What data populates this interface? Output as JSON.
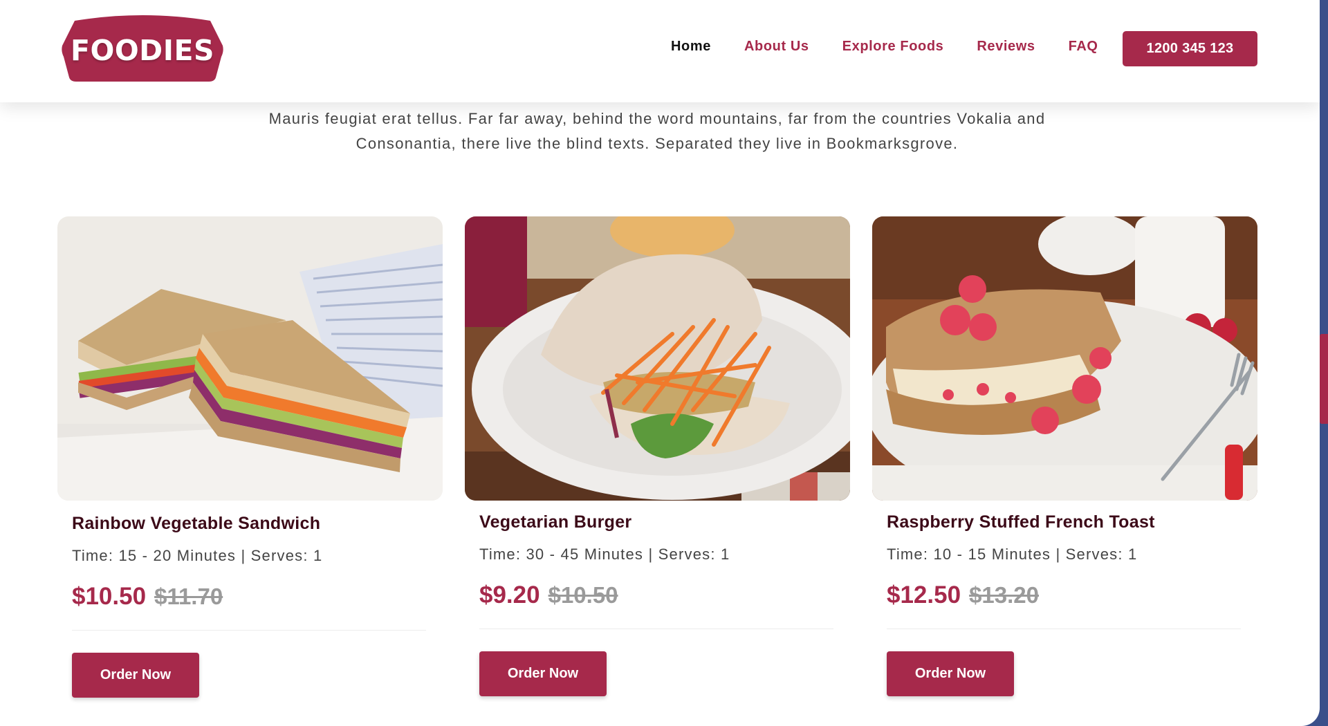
{
  "header": {
    "logo_text": "FOODIES",
    "nav": [
      {
        "label": "Home",
        "active": true
      },
      {
        "label": "About Us",
        "active": false
      },
      {
        "label": "Explore Foods",
        "active": false
      },
      {
        "label": "Reviews",
        "active": false
      },
      {
        "label": "FAQ",
        "active": false
      }
    ],
    "phone": "1200 345 123"
  },
  "intro": {
    "line1": "Mauris feugiat erat tellus. Far far away, behind the word mountains, far from the countries Vokalia and",
    "line2": "Consonantia, there live the blind texts. Separated they live in Bookmarksgrove."
  },
  "cards": [
    {
      "title": "Rainbow Vegetable Sandwich",
      "meta": "Time: 15 - 20 Minutes | Serves: 1",
      "price": "$10.50",
      "old_price": "$11.70",
      "button": "Order Now",
      "image": "rainbow-vegetable-sandwich-photo"
    },
    {
      "title": "Vegetarian Burger",
      "meta": "Time: 30 - 45 Minutes | Serves: 1",
      "price": "$9.20",
      "old_price": "$10.50",
      "button": "Order Now",
      "image": "vegetarian-burger-photo"
    },
    {
      "title": "Raspberry Stuffed French Toast",
      "meta": "Time: 10 - 15 Minutes | Serves: 1",
      "price": "$12.50",
      "old_price": "$13.20",
      "button": "Order Now",
      "image": "raspberry-french-toast-photo"
    }
  ],
  "colors": {
    "accent": "#a6294b",
    "title": "#3c0a18",
    "text": "#444444",
    "old_price": "#9a9a9a",
    "frame": "#3a4f8a"
  }
}
